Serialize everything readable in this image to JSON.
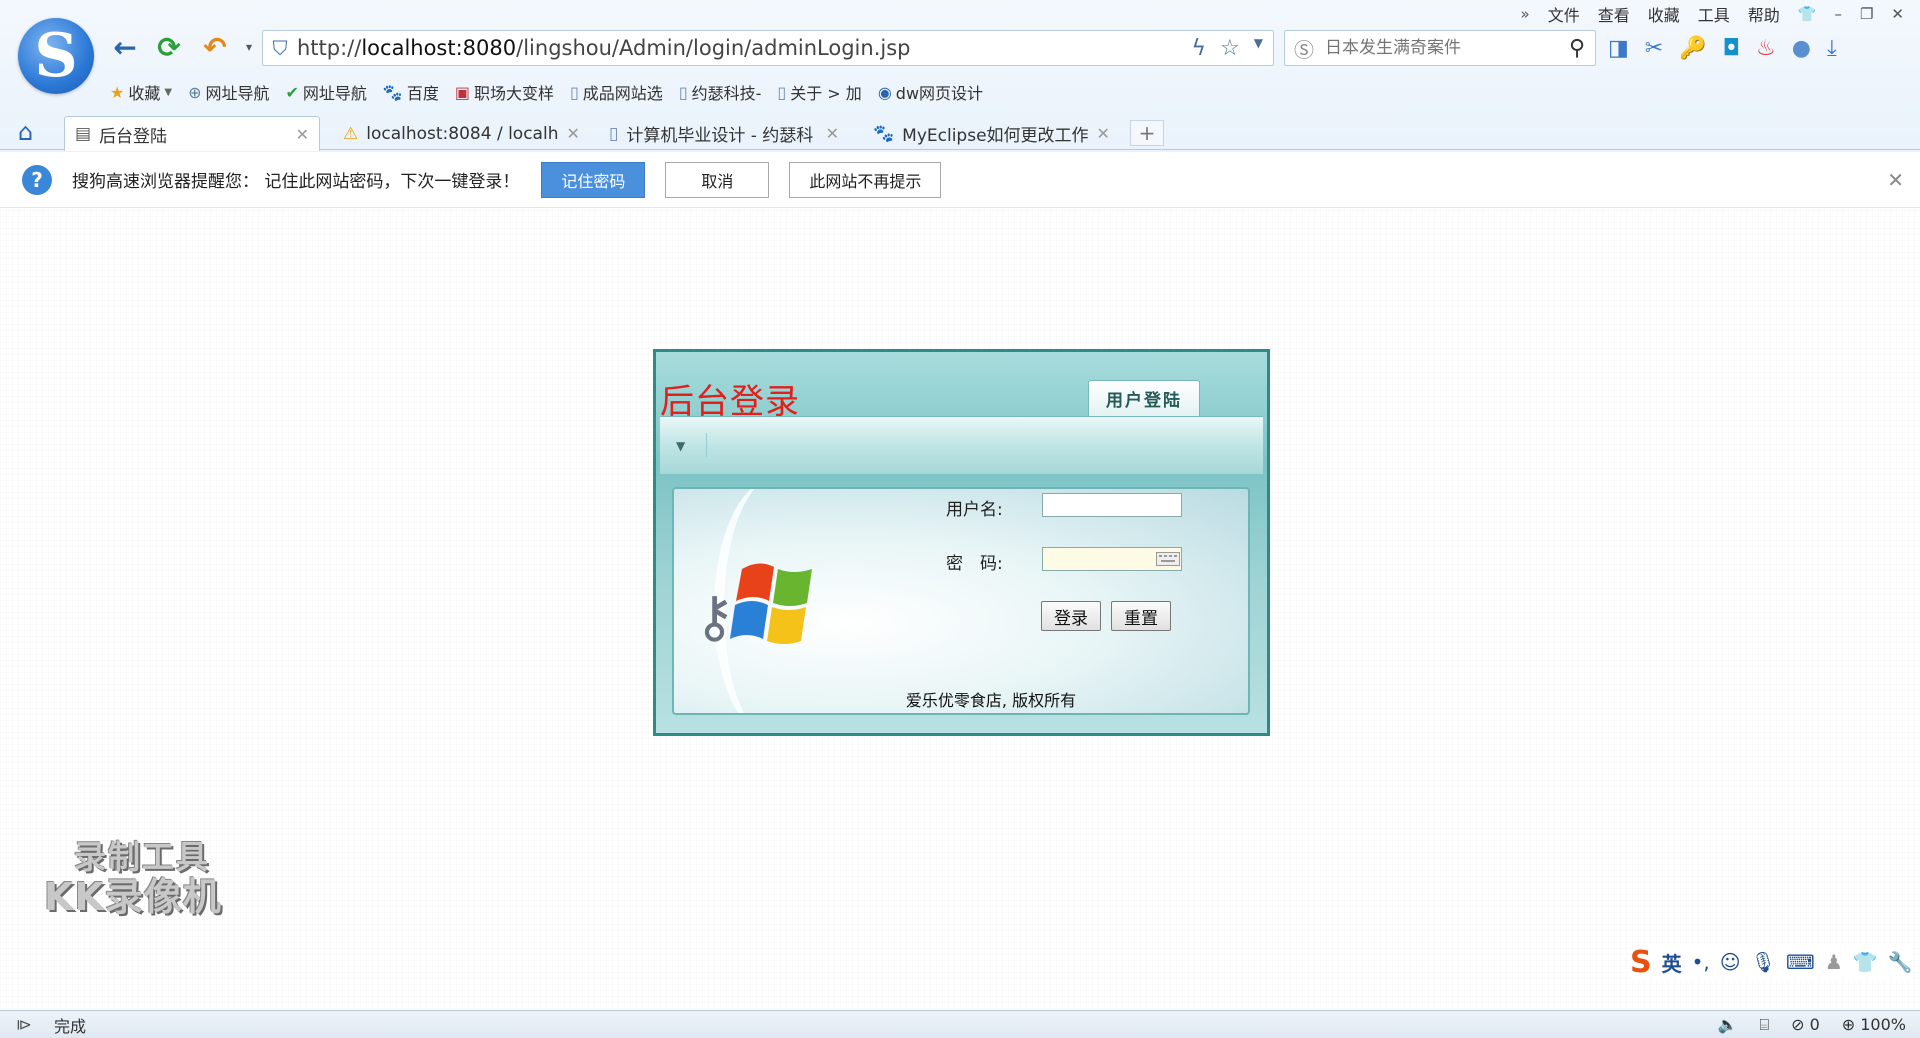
{
  "browser": {
    "logo_letter": "S",
    "menu": [
      "文件",
      "查看",
      "收藏",
      "工具",
      "帮助"
    ],
    "address": {
      "url_prefix": "http://",
      "url_host": "localhost:8080",
      "url_path": "/lingshou/Admin/login/adminLogin.jsp"
    },
    "search": {
      "placeholder": "日本发生满奇案件"
    },
    "bookmarks": [
      {
        "label": "收藏",
        "icon": "star-icon"
      },
      {
        "label": "网址导航",
        "icon": "globe-icon"
      },
      {
        "label": "网址导航",
        "icon": "hao-icon"
      },
      {
        "label": "百度",
        "icon": "baidu-icon"
      },
      {
        "label": "职场大变样",
        "icon": "app-icon"
      },
      {
        "label": "成品网站选",
        "icon": "page-icon"
      },
      {
        "label": "约瑟科技-",
        "icon": "page-icon"
      },
      {
        "label": "关于 > 加",
        "icon": "page-icon"
      },
      {
        "label": "dw网页设计",
        "icon": "eye-icon"
      }
    ],
    "tabs": [
      {
        "label": "后台登陆",
        "active": true
      },
      {
        "label": "localhost:8084 / localh",
        "active": false
      },
      {
        "label": "计算机毕业设计 - 约瑟科",
        "active": false
      },
      {
        "label": "MyEclipse如何更改工作",
        "active": false
      }
    ],
    "notice": {
      "message": "搜狗高速浏览器提醒您： 记住此网站密码，下次一键登录！",
      "remember": "记住密码",
      "cancel": "取消",
      "never": "此网站不再提示"
    },
    "status": {
      "text": "完成",
      "zoom": "100%",
      "blocked_count": "0"
    }
  },
  "login": {
    "title": "后台登录",
    "tab": "用户登陆",
    "username_label": "用户名:",
    "username_value": "",
    "password_label": "密　码:",
    "password_value": "",
    "login_button": "登录",
    "reset_button": "重置",
    "copyright": "爱乐优零食店, 版权所有"
  },
  "overlay": {
    "watermark_line1": "录制工具",
    "watermark_line2": "KK录像机",
    "ime_lang": "英"
  },
  "colors": {
    "title_red": "#e0201a",
    "frame_teal": "#2e8b84",
    "accent_blue": "#4a90dc"
  }
}
